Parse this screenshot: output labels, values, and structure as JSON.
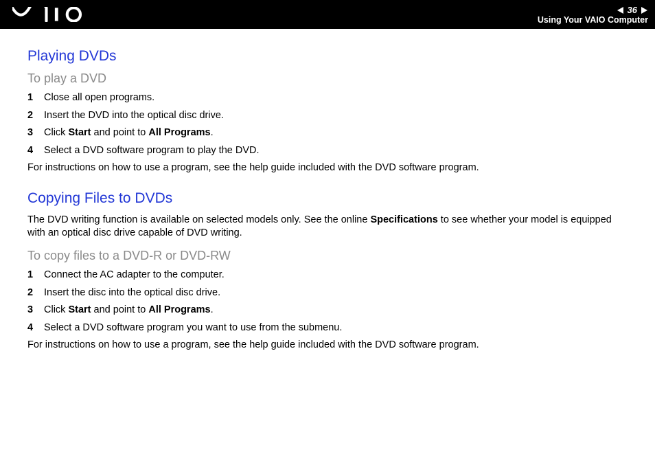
{
  "header": {
    "page_number": "36",
    "section": "Using Your VAIO Computer"
  },
  "section1": {
    "title": "Playing DVDs",
    "subtitle": "To play a DVD",
    "steps": [
      "Close all open programs.",
      "Insert the DVD into the optical disc drive."
    ],
    "step3_pre": "Click ",
    "step3_b1": "Start",
    "step3_mid": " and point to ",
    "step3_b2": "All Programs",
    "step3_post": ".",
    "step4": "Select a DVD software program to play the DVD.",
    "note": "For instructions on how to use a program, see the help guide included with the DVD software program."
  },
  "section2": {
    "title": "Copying Files to DVDs",
    "intro_pre": "The DVD writing function is available on selected models only. See the online ",
    "intro_b": "Specifications",
    "intro_post": " to see whether your model is equipped with an optical disc drive capable of DVD writing.",
    "subtitle": "To copy files to a DVD-R or DVD-RW",
    "steps": [
      "Connect the AC adapter to the computer.",
      "Insert the disc into the optical disc drive."
    ],
    "step3_pre": "Click ",
    "step3_b1": "Start",
    "step3_mid": " and point to ",
    "step3_b2": "All Programs",
    "step3_post": ".",
    "step4": "Select a DVD software program you want to use from the submenu.",
    "note": "For instructions on how to use a program, see the help guide included with the DVD software program."
  },
  "nums": {
    "n1": "1",
    "n2": "2",
    "n3": "3",
    "n4": "4"
  }
}
